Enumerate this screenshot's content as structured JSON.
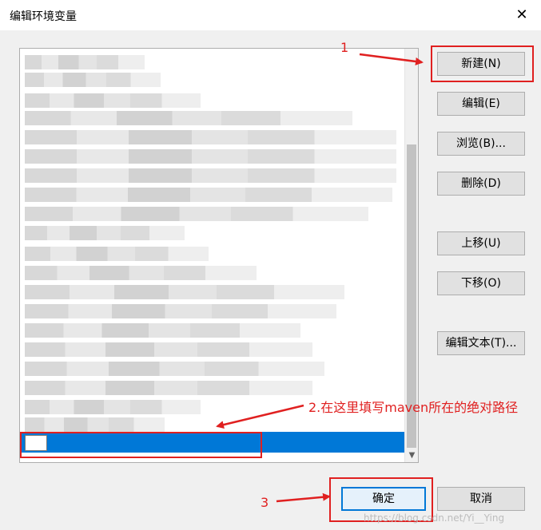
{
  "window": {
    "title": "编辑环境变量",
    "close_glyph": "✕"
  },
  "list": {
    "blurred_item_count": 20,
    "edit_value": ""
  },
  "buttons": {
    "new": "新建(N)",
    "edit": "编辑(E)",
    "browse": "浏览(B)...",
    "delete": "删除(D)",
    "move_up": "上移(U)",
    "move_down": "下移(O)",
    "edit_text": "编辑文本(T)...",
    "ok": "确定",
    "cancel": "取消"
  },
  "annotations": {
    "step1": "1",
    "step2": "2.在这里填写maven所在的绝对路径",
    "step3": "3",
    "color": "#e02020"
  },
  "watermark": "https://blog.csdn.net/Yi__Ying",
  "colors": {
    "selection": "#0078d7",
    "button_bg": "#e1e1e1",
    "window_bg": "#f0f0f0"
  },
  "icons": {
    "close": "close-icon",
    "scroll_down": "chevron-down-icon"
  }
}
